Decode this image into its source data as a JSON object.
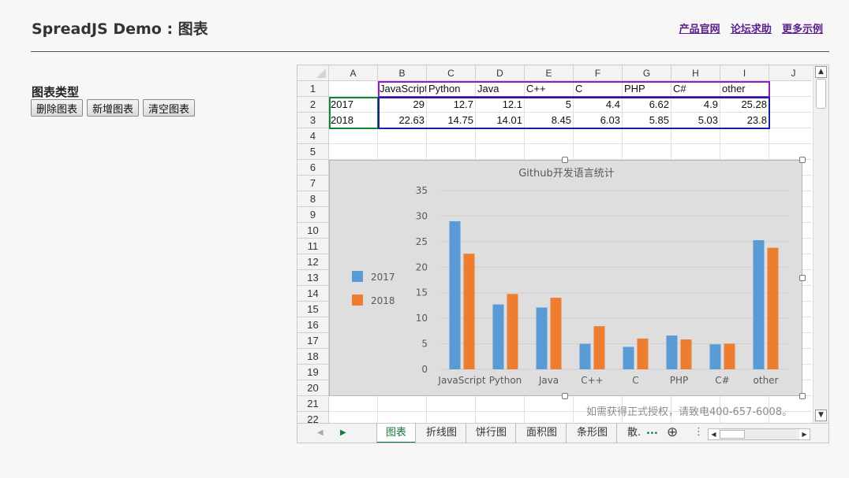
{
  "header": {
    "title": "SpreadJS Demo : 图表",
    "links": [
      "产品官网",
      "论坛求助",
      "更多示例"
    ]
  },
  "sidebar": {
    "label": "图表类型",
    "buttons": [
      "删除图表",
      "新增图表",
      "清空图表"
    ]
  },
  "sheet": {
    "columns": [
      "A",
      "B",
      "C",
      "D",
      "E",
      "F",
      "G",
      "H",
      "I",
      "J"
    ],
    "rows": [
      "1",
      "2",
      "3",
      "4",
      "5",
      "6",
      "7",
      "8",
      "9",
      "10",
      "11",
      "12",
      "13",
      "14",
      "15",
      "16",
      "17",
      "18",
      "19",
      "20",
      "21",
      "22"
    ],
    "cells": [
      [
        "",
        "JavaScript",
        "Python",
        "Java",
        "C++",
        "C",
        "PHP",
        "C#",
        "other",
        ""
      ],
      [
        "2017",
        "29",
        "12.7",
        "12.1",
        "5",
        "4.4",
        "6.62",
        "4.9",
        "25.28",
        ""
      ],
      [
        "2018",
        "22.63",
        "14.75",
        "14.01",
        "8.45",
        "6.03",
        "5.85",
        "5.03",
        "23.8",
        ""
      ]
    ]
  },
  "chart_data": {
    "type": "bar",
    "title": "Github开发语言统计",
    "categories": [
      "JavaScript",
      "Python",
      "Java",
      "C++",
      "C",
      "PHP",
      "C#",
      "other"
    ],
    "series": [
      {
        "name": "2017",
        "color": "#5b9bd5",
        "values": [
          29,
          12.7,
          12.1,
          5,
          4.4,
          6.62,
          4.9,
          25.28
        ]
      },
      {
        "name": "2018",
        "color": "#ed7d31",
        "values": [
          22.63,
          14.75,
          14.01,
          8.45,
          6.03,
          5.85,
          5.03,
          23.8
        ]
      }
    ],
    "y_ticks": [
      "0",
      "5",
      "10",
      "15",
      "20",
      "25",
      "30",
      "35"
    ],
    "ylim": [
      0,
      35
    ],
    "legend_position": "left",
    "grid": true
  },
  "watermark": "如需获得正式授权，请致电400-657-6008。",
  "tabs": {
    "sheets": [
      "图表",
      "折线图",
      "饼行图",
      "面积图",
      "条形图",
      "散."
    ],
    "more": "...",
    "add": "⊕",
    "menu": "⋮"
  }
}
